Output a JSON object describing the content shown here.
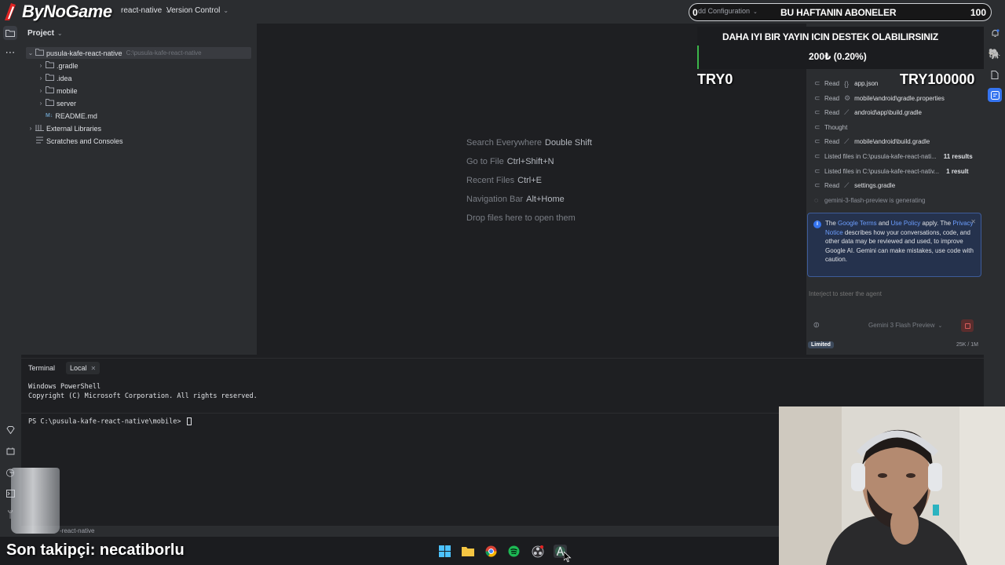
{
  "overlay": {
    "brand": "ByNoGame",
    "subs_count_left": "0",
    "subs_title": "BU HAFTANIN ABONELER",
    "subs_count_right": "100",
    "donation_message": "DAHA IYI BIR YAYIN ICIN DESTEK OLABILIRSINIZ",
    "donation_amount": "200₺ (0.20%)",
    "goal_start": "TRY0",
    "goal_end": "TRY100000",
    "last_follower": "Son takipçi: necatiborlu"
  },
  "topbar": {
    "project_menu": "react-native",
    "vcs_menu": "Version Control",
    "run_config": "dd Configuration"
  },
  "project_panel": {
    "title": "Project",
    "tree": [
      {
        "label": "pusula-kafe-react-native",
        "path": "C:\\pusula-kafe-react-native",
        "icon": "folder-icon",
        "level": 0,
        "expanded": true
      },
      {
        "label": ".gradle",
        "icon": "folder-icon",
        "level": 1,
        "expanded": false
      },
      {
        "label": ".idea",
        "icon": "folder-icon",
        "level": 1,
        "expanded": false
      },
      {
        "label": "mobile",
        "icon": "folder-icon",
        "level": 1,
        "expanded": false
      },
      {
        "label": "server",
        "icon": "folder-icon",
        "level": 1,
        "expanded": false
      },
      {
        "label": "README.md",
        "icon": "markdown-file-icon",
        "badge": "M↓",
        "level": 1
      },
      {
        "label": "External Libraries",
        "icon": "library-icon",
        "level": 0,
        "expanded": false
      },
      {
        "label": "Scratches and Consoles",
        "icon": "scratches-icon",
        "level": 0
      }
    ]
  },
  "editor_hints": [
    {
      "label": "Search Everywhere",
      "shortcut": "Double Shift"
    },
    {
      "label": "Go to File",
      "shortcut": "Ctrl+Shift+N"
    },
    {
      "label": "Recent Files",
      "shortcut": "Ctrl+E"
    },
    {
      "label": "Navigation Bar",
      "shortcut": "Alt+Home"
    },
    {
      "label": "Drop files here to open them",
      "shortcut": ""
    }
  ],
  "agent": {
    "activity": [
      {
        "verb": "Read",
        "icon": "braces-icon",
        "target": "app.json"
      },
      {
        "verb": "Read",
        "icon": "gear-icon",
        "target": "mobile\\android\\gradle.properties"
      },
      {
        "verb": "Read",
        "icon": "gradle-icon",
        "target": "android\\app\\build.gradle"
      },
      {
        "verb": "Thought",
        "icon": "",
        "target": ""
      },
      {
        "verb": "Read",
        "icon": "gradle-icon",
        "target": "mobile\\android\\build.gradle"
      },
      {
        "verb": "Listed files in C:\\pusula-kafe-react-nati...",
        "icon": "",
        "target": "",
        "count": "11 results"
      },
      {
        "verb": "Listed files in C:\\pusula-kafe-react-nativ...",
        "icon": "",
        "target": "",
        "count": "1 result"
      },
      {
        "verb": "Read",
        "icon": "gradle-icon",
        "target": "settings.gradle"
      }
    ],
    "generating": "gemini-3-flash-preview is generating",
    "notice": {
      "p1": "The ",
      "google_terms": "Google Terms",
      "p2": " and ",
      "use_policy": "Use Policy",
      "p3": " apply. The ",
      "privacy_notice": "Privacy Notice",
      "p4": " describes how your conversations, code, and other data may be reviewed and used, to improve Google AI. Gemini can make mistakes, use code with caution."
    },
    "input_placeholder": "Interject to steer the agent",
    "model": "Gemini 3 Flash Preview",
    "limited": "Limited",
    "tokens": "25K / 1M"
  },
  "terminal": {
    "tab_title": "Terminal",
    "session": "Local",
    "lines": [
      "Windows PowerShell",
      "Copyright (C) Microsoft Corporation. All rights reserved."
    ],
    "prompt": "PS C:\\pusula-kafe-react-native\\mobile> "
  },
  "statusbar": {
    "text": "-react-native"
  },
  "colors": {
    "accent": "#3574f0",
    "background": "#1e1f22",
    "panel": "#2b2d30"
  }
}
